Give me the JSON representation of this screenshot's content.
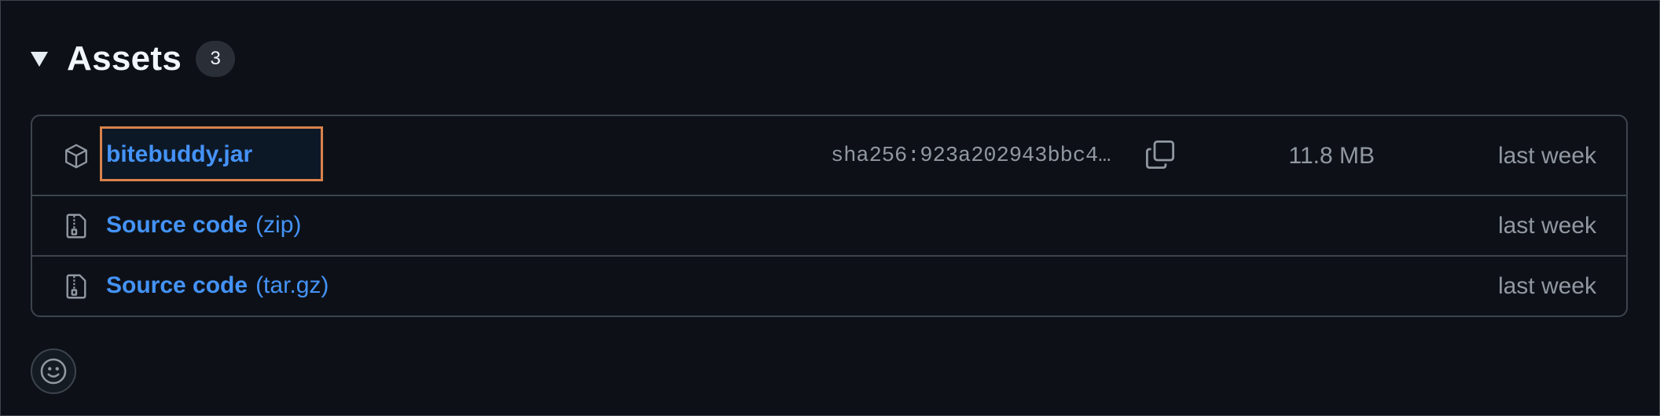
{
  "assets": {
    "title": "Assets",
    "count": "3",
    "items": [
      {
        "name": "bitebuddy.jar",
        "suffix": "",
        "icon": "package-icon",
        "sha": "sha256:923a202943bbc4…",
        "size": "11.8 MB",
        "date": "last week"
      },
      {
        "name": "Source code",
        "suffix": "(zip)",
        "icon": "file-zip-icon",
        "date": "last week"
      },
      {
        "name": "Source code",
        "suffix": "(tar.gz)",
        "icon": "file-zip-icon",
        "date": "last week"
      }
    ]
  },
  "reactions": {
    "icon": "smiley-icon"
  },
  "colors": {
    "background": "#0d1117",
    "border": "#3d444d",
    "link": "#4493f8",
    "muted": "#9198a1",
    "highlight_outline": "#d9824a"
  }
}
